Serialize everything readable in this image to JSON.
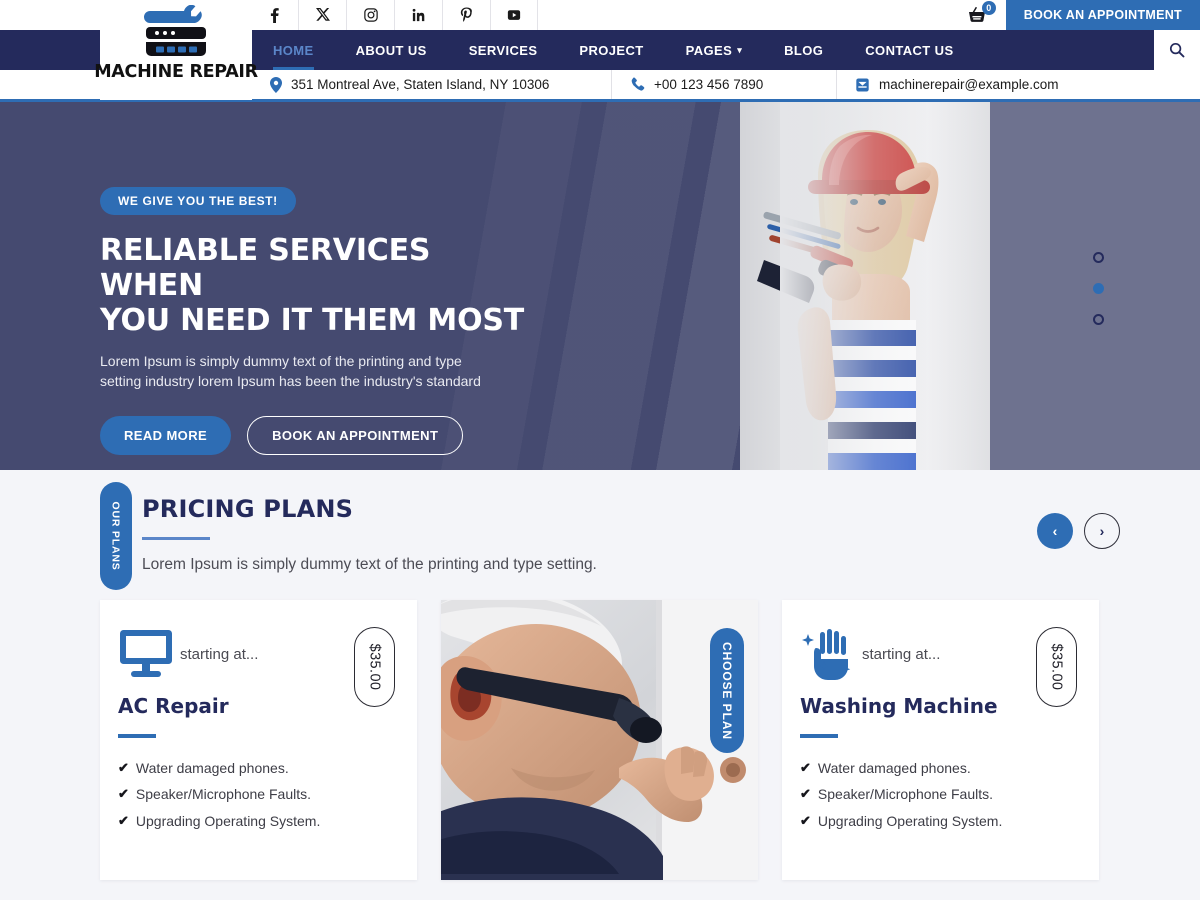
{
  "topbar": {
    "socials": [
      {
        "name": "facebook-icon",
        "label": "f"
      },
      {
        "name": "x-twitter-icon",
        "label": "X"
      },
      {
        "name": "instagram-icon",
        "label": "Instagram"
      },
      {
        "name": "linkedin-icon",
        "label": "in"
      },
      {
        "name": "pinterest-icon",
        "label": "P"
      },
      {
        "name": "youtube-icon",
        "label": "YouTube"
      }
    ],
    "cart_count": "0",
    "appointment_label": "BOOK AN APPOINTMENT"
  },
  "logo": {
    "text": "MACHINE REPAIR"
  },
  "nav": {
    "items": [
      {
        "label": "HOME",
        "active": true,
        "caret": false
      },
      {
        "label": "ABOUT US",
        "active": false,
        "caret": false
      },
      {
        "label": "SERVICES",
        "active": false,
        "caret": false
      },
      {
        "label": "PROJECT",
        "active": false,
        "caret": false
      },
      {
        "label": "PAGES",
        "active": false,
        "caret": true
      },
      {
        "label": "BLOG",
        "active": false,
        "caret": false
      },
      {
        "label": "CONTACT US",
        "active": false,
        "caret": false
      }
    ],
    "caret_glyph": "▾"
  },
  "contact": {
    "address": "351 Montreal Ave, Staten Island, NY 10306",
    "phone": "+00 123 456 7890",
    "email": "machinerepair@example.com"
  },
  "hero": {
    "badge": "WE GIVE YOU THE BEST!",
    "title_line1": "RELIABLE SERVICES WHEN",
    "title_line2": "YOU NEED IT THEM MOST",
    "subtitle_line1": "Lorem Ipsum is simply dummy text of the printing and type",
    "subtitle_line2": "setting industry lorem Ipsum has been the industry's standard",
    "primary_btn": "READ MORE",
    "secondary_btn": "BOOK AN APPOINTMENT",
    "slide_count": 3,
    "active_slide": 2
  },
  "pricing": {
    "tab_label": "OUR PLANS",
    "title": "PRICING PLANS",
    "subtitle": "Lorem Ipsum is simply dummy text of the printing and type setting.",
    "prev_glyph": "‹",
    "next_glyph": "›",
    "featured_tab_label": "CHOOSE PLAN",
    "cards": [
      {
        "icon": "monitor-icon",
        "starting_at": "starting at...",
        "title": "AC Repair",
        "price": "$35.00",
        "features": [
          "Water damaged phones.",
          "Speaker/Microphone Faults.",
          "Upgrading Operating System."
        ]
      },
      {
        "icon": "clean-hand-icon",
        "starting_at": "starting at...",
        "title": "Washing Machine",
        "price": "$35.00",
        "features": [
          "Water damaged phones.",
          "Speaker/Microphone Faults.",
          "Upgrading Operating System."
        ]
      }
    ],
    "tick_glyph": "✔"
  },
  "colors": {
    "brand_blue": "#2e6db4",
    "navy": "#242a5c",
    "hero_bg": "#454a70",
    "page_bg": "#f4f5f9"
  }
}
